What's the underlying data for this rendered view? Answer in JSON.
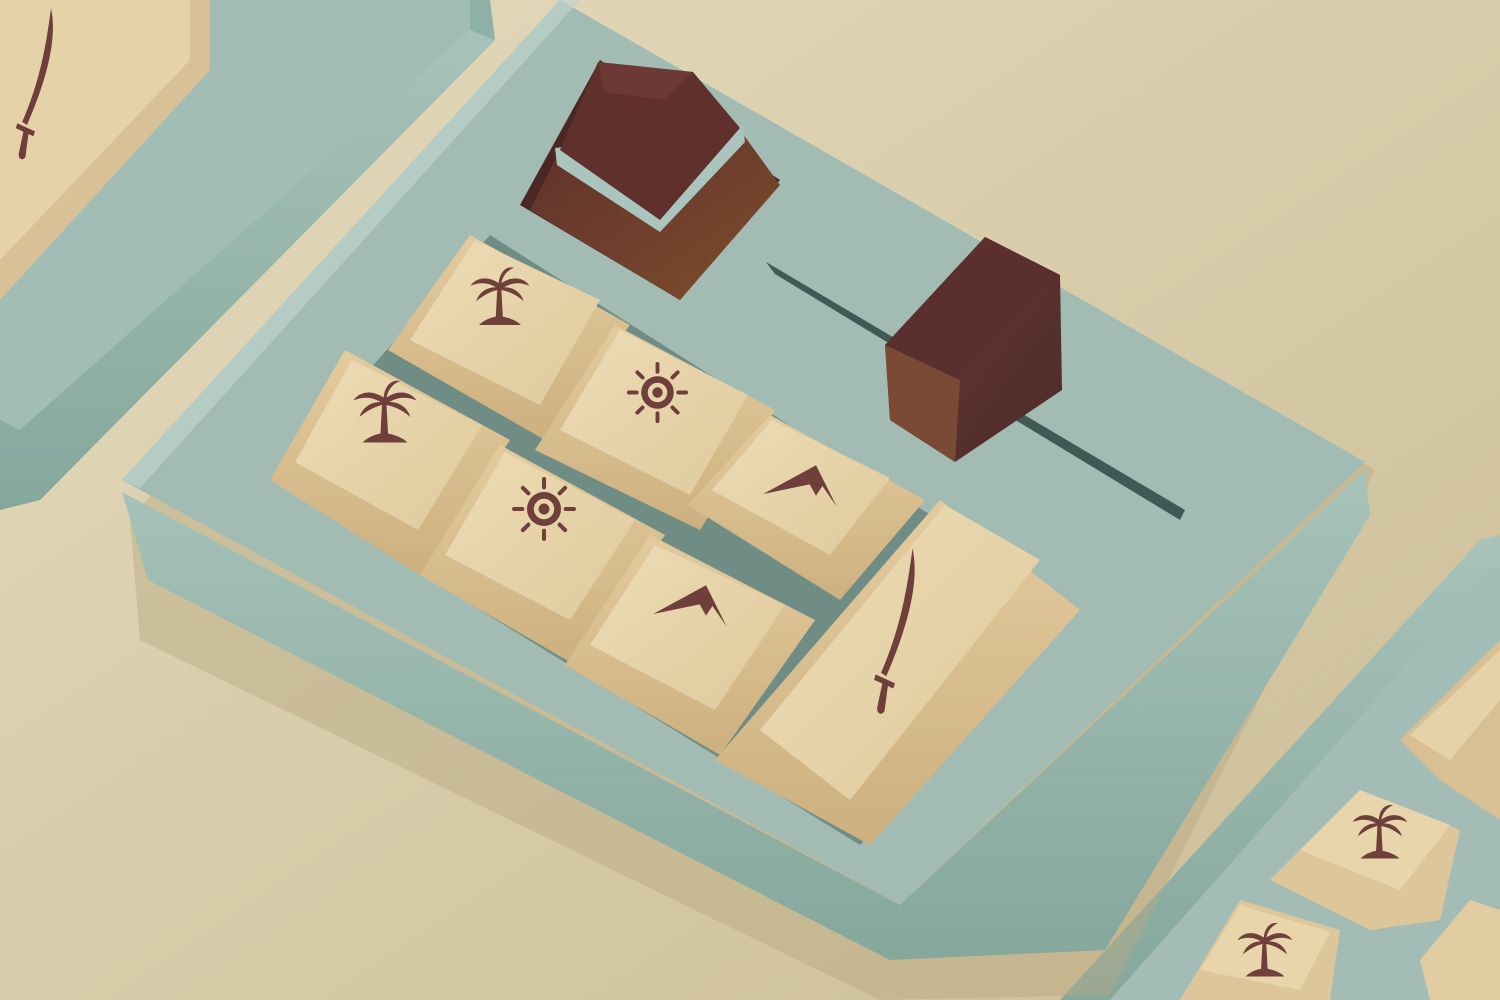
{
  "scene": {
    "subject": "macropad",
    "colors": {
      "background_light": "#e1d8b9",
      "background_dark": "#cdbf98",
      "case_top": "#a3bcb5",
      "case_side": "#8aaca2",
      "case_edge_light": "#bdd3cb",
      "slot": "#4f6a64",
      "keycap_top": "#e8d5ac",
      "keycap_side": "#d9c094",
      "keycap_dark": "#c9ac7c",
      "legend": "#6e3f3b",
      "accent_key": "#5a2f2b",
      "accent_key_side": "#7b4a2d",
      "accent_stripe": "#a9c5bd",
      "slider_knob": "#5b302e",
      "slider_knob_side": "#7a4a36"
    },
    "keys": [
      {
        "legend": "palm-tree-icon"
      },
      {
        "legend": "sun-icon"
      },
      {
        "legend": "palm-tree-icon"
      },
      {
        "legend": "sun-icon"
      },
      {
        "legend": "mountain-icon"
      },
      {
        "legend": "mountain-icon"
      },
      {
        "legend": "sword-icon"
      }
    ],
    "accent_keycap": {
      "legend": ""
    },
    "slider": {
      "orientation": "diagonal"
    },
    "neighbors": [
      "macropad-left-partial",
      "macropad-right-partial"
    ]
  }
}
